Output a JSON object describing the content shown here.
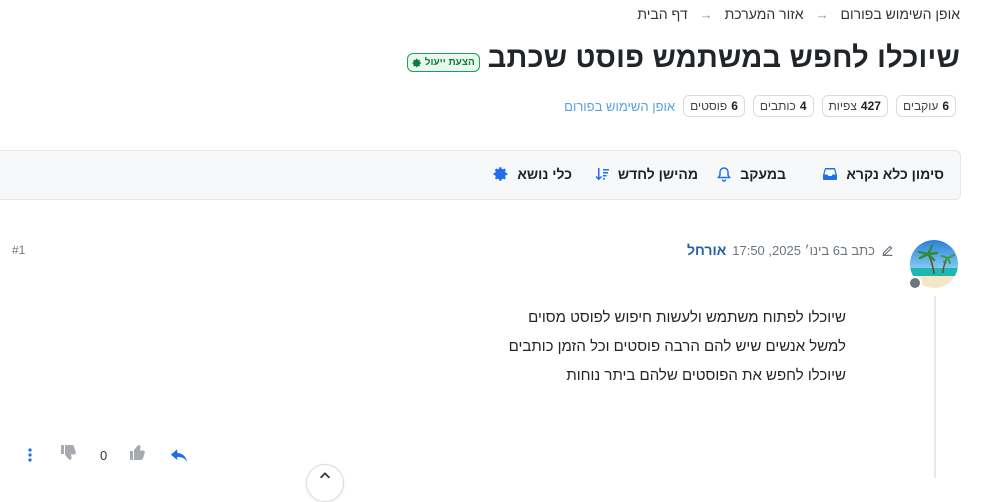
{
  "breadcrumb": {
    "items": [
      "דף הבית",
      "אזור המערכת",
      "אופן השימוש בפורום"
    ],
    "separator": "→"
  },
  "topic": {
    "badge": "הצעת ייעול",
    "title": "שיוכלו לחפש במשתמש פוסט שכתב",
    "category": "אופן השימוש בפורום"
  },
  "stats": [
    {
      "value": "6",
      "label": "פוסטים"
    },
    {
      "value": "4",
      "label": "כותבים"
    },
    {
      "value": "427",
      "label": "צפיות"
    },
    {
      "value": "6",
      "label": "עוקבים"
    }
  ],
  "toolbar": {
    "mark_unread": "סימון כלא נקרא",
    "watching": "במעקב",
    "sort": "מהישן לחדש",
    "topic_tools": "כלי נושא"
  },
  "post": {
    "author": "אורחל",
    "meta": "כתב ב6 בינו׳ 2025, 17:50",
    "index": "#1",
    "lines": [
      "שיוכלו לפתוח משתמש ולעשות חיפוש לפוסט מסוים",
      "למשל אנשים שיש להם הרבה פוסטים וכל הזמן כותבים",
      "שיוכלו לחפש את הפוסטים שלהם ביתר נוחות"
    ],
    "votes": "0"
  },
  "colors": {
    "accent": "#1f6feb",
    "badge_green": "#1a9f5c",
    "category_link": "#5aa1e0",
    "author": "#1f5fa8"
  },
  "icons": [
    "inbox-icon",
    "bell-icon",
    "sort-icon",
    "gear-icon",
    "edit-icon",
    "thumbs-up-icon",
    "thumbs-down-icon",
    "reply-icon",
    "more-vertical-icon",
    "chevron-up-icon"
  ]
}
